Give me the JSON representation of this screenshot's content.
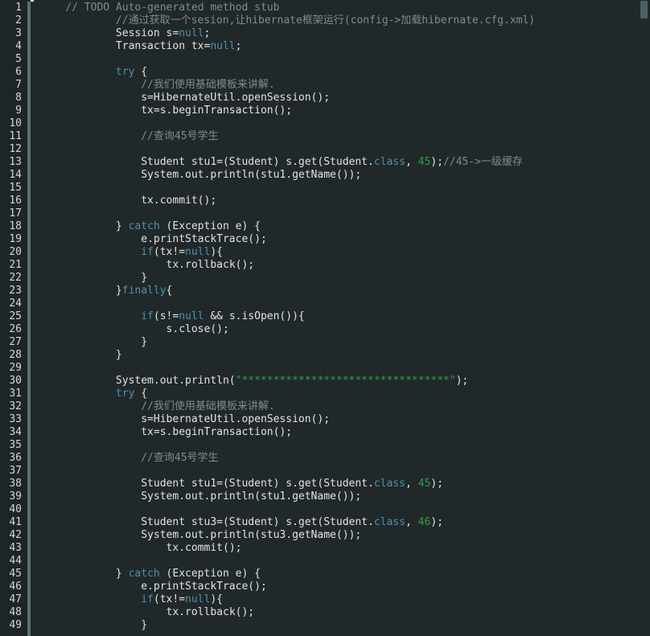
{
  "editor": {
    "title": "Java source editor",
    "language": "java",
    "theme": "dark",
    "gutter": {
      "first_line": 1,
      "last_line": 49,
      "line_count": 49
    },
    "colors": {
      "background": "#212829",
      "gutter_background": "#1e2527",
      "fold_bar": "#5b7173",
      "default_text": "#e3e3e3",
      "line_number": "#d6d6d6",
      "keyword": "#4e90b0",
      "number": "#2f9e46",
      "string": "#2f9e46",
      "comment": "#7f8c8d",
      "scrollbar_thumb": "#4c6164"
    },
    "scrollbar": {
      "orientation": "vertical",
      "thumb_position": "top"
    },
    "lines": [
      {
        "n": 1,
        "tokens": [
          {
            "t": "// TODO Auto-generated method stub",
            "c": "cmt",
            "indent": 1
          }
        ]
      },
      {
        "n": 2,
        "tokens": [
          {
            "t": "//通过获取一个sesion,让hibernate框架运行(config->加载hibernate.cfg.xml)",
            "c": "cmt",
            "indent": 3
          }
        ]
      },
      {
        "n": 3,
        "tokens": [
          {
            "t": "Session s=",
            "c": "plain",
            "indent": 3
          },
          {
            "t": "null",
            "c": "kw"
          },
          {
            "t": ";",
            "c": "plain"
          }
        ]
      },
      {
        "n": 4,
        "tokens": [
          {
            "t": "Transaction tx=",
            "c": "plain",
            "indent": 3
          },
          {
            "t": "null",
            "c": "kw"
          },
          {
            "t": ";",
            "c": "plain"
          }
        ]
      },
      {
        "n": 5,
        "tokens": []
      },
      {
        "n": 6,
        "tokens": [
          {
            "t": "try",
            "c": "kw",
            "indent": 3
          },
          {
            "t": " {",
            "c": "plain"
          }
        ]
      },
      {
        "n": 7,
        "tokens": [
          {
            "t": "//我们使用基础模板来讲解.",
            "c": "cmt",
            "indent": 4
          }
        ]
      },
      {
        "n": 8,
        "tokens": [
          {
            "t": "s=HibernateUtil.openSession();",
            "c": "plain",
            "indent": 4
          }
        ]
      },
      {
        "n": 9,
        "tokens": [
          {
            "t": "tx=s.beginTransaction();",
            "c": "plain",
            "indent": 4
          }
        ]
      },
      {
        "n": 10,
        "tokens": []
      },
      {
        "n": 11,
        "tokens": [
          {
            "t": "//查询45号学生",
            "c": "cmt",
            "indent": 4
          }
        ]
      },
      {
        "n": 12,
        "tokens": []
      },
      {
        "n": 13,
        "tokens": [
          {
            "t": "Student stu1=(Student) s.get(Student.",
            "c": "plain",
            "indent": 4
          },
          {
            "t": "class",
            "c": "kw"
          },
          {
            "t": ", ",
            "c": "plain"
          },
          {
            "t": "45",
            "c": "num"
          },
          {
            "t": ");",
            "c": "plain"
          },
          {
            "t": "//45->一级缓存",
            "c": "cmt"
          }
        ]
      },
      {
        "n": 14,
        "tokens": [
          {
            "t": "System.out.println(stu1.getName());",
            "c": "plain",
            "indent": 4
          }
        ]
      },
      {
        "n": 15,
        "tokens": []
      },
      {
        "n": 16,
        "tokens": [
          {
            "t": "tx.commit();",
            "c": "plain",
            "indent": 4
          }
        ]
      },
      {
        "n": 17,
        "tokens": []
      },
      {
        "n": 18,
        "tokens": [
          {
            "t": "} ",
            "c": "plain",
            "indent": 3
          },
          {
            "t": "catch",
            "c": "kw"
          },
          {
            "t": " (Exception e) {",
            "c": "plain"
          }
        ]
      },
      {
        "n": 19,
        "tokens": [
          {
            "t": "e.printStackTrace();",
            "c": "plain",
            "indent": 4
          }
        ]
      },
      {
        "n": 20,
        "tokens": [
          {
            "t": "if",
            "c": "kw",
            "indent": 4
          },
          {
            "t": "(tx!=",
            "c": "plain"
          },
          {
            "t": "null",
            "c": "kw"
          },
          {
            "t": "){",
            "c": "plain"
          }
        ]
      },
      {
        "n": 21,
        "tokens": [
          {
            "t": "tx.rollback();",
            "c": "plain",
            "indent": 5
          }
        ]
      },
      {
        "n": 22,
        "tokens": [
          {
            "t": "}",
            "c": "plain",
            "indent": 4
          }
        ]
      },
      {
        "n": 23,
        "tokens": [
          {
            "t": "}",
            "c": "plain",
            "indent": 3
          },
          {
            "t": "finally",
            "c": "kw"
          },
          {
            "t": "{",
            "c": "plain"
          }
        ]
      },
      {
        "n": 24,
        "tokens": []
      },
      {
        "n": 25,
        "tokens": [
          {
            "t": "if",
            "c": "kw",
            "indent": 4
          },
          {
            "t": "(s!=",
            "c": "plain"
          },
          {
            "t": "null",
            "c": "kw"
          },
          {
            "t": " && s.isOpen()){",
            "c": "plain"
          }
        ]
      },
      {
        "n": 26,
        "tokens": [
          {
            "t": "s.close();",
            "c": "plain",
            "indent": 5
          }
        ]
      },
      {
        "n": 27,
        "tokens": [
          {
            "t": "}",
            "c": "plain",
            "indent": 4
          }
        ]
      },
      {
        "n": 28,
        "tokens": [
          {
            "t": "}",
            "c": "plain",
            "indent": 3
          }
        ]
      },
      {
        "n": 29,
        "tokens": []
      },
      {
        "n": 30,
        "tokens": [
          {
            "t": "System.out.println(",
            "c": "plain",
            "indent": 3
          },
          {
            "t": "\"*********************************\"",
            "c": "str"
          },
          {
            "t": ");",
            "c": "plain"
          }
        ]
      },
      {
        "n": 31,
        "tokens": [
          {
            "t": "try",
            "c": "kw",
            "indent": 3
          },
          {
            "t": " {",
            "c": "plain"
          }
        ]
      },
      {
        "n": 32,
        "tokens": [
          {
            "t": "//我们使用基础模板来讲解.",
            "c": "cmt",
            "indent": 4
          }
        ]
      },
      {
        "n": 33,
        "tokens": [
          {
            "t": "s=HibernateUtil.openSession();",
            "c": "plain",
            "indent": 4
          }
        ]
      },
      {
        "n": 34,
        "tokens": [
          {
            "t": "tx=s.beginTransaction();",
            "c": "plain",
            "indent": 4
          }
        ]
      },
      {
        "n": 35,
        "tokens": []
      },
      {
        "n": 36,
        "tokens": [
          {
            "t": "//查询45号学生",
            "c": "cmt",
            "indent": 4
          }
        ]
      },
      {
        "n": 37,
        "tokens": []
      },
      {
        "n": 38,
        "tokens": [
          {
            "t": "Student stu1=(Student) s.get(Student.",
            "c": "plain",
            "indent": 4
          },
          {
            "t": "class",
            "c": "kw"
          },
          {
            "t": ", ",
            "c": "plain"
          },
          {
            "t": "45",
            "c": "num"
          },
          {
            "t": ");",
            "c": "plain"
          }
        ]
      },
      {
        "n": 39,
        "tokens": [
          {
            "t": "System.out.println(stu1.getName());",
            "c": "plain",
            "indent": 4
          }
        ]
      },
      {
        "n": 40,
        "tokens": []
      },
      {
        "n": 41,
        "tokens": [
          {
            "t": "Student stu3=(Student) s.get(Student.",
            "c": "plain",
            "indent": 4
          },
          {
            "t": "class",
            "c": "kw"
          },
          {
            "t": ", ",
            "c": "plain"
          },
          {
            "t": "46",
            "c": "num"
          },
          {
            "t": ");",
            "c": "plain"
          }
        ]
      },
      {
        "n": 42,
        "tokens": [
          {
            "t": "System.out.println(stu3.getName());",
            "c": "plain",
            "indent": 4
          }
        ]
      },
      {
        "n": 43,
        "tokens": [
          {
            "t": "tx.commit();",
            "c": "plain",
            "indent": 5
          }
        ]
      },
      {
        "n": 44,
        "tokens": []
      },
      {
        "n": 45,
        "tokens": [
          {
            "t": "} ",
            "c": "plain",
            "indent": 3
          },
          {
            "t": "catch",
            "c": "kw"
          },
          {
            "t": " (Exception e) {",
            "c": "plain"
          }
        ]
      },
      {
        "n": 46,
        "tokens": [
          {
            "t": "e.printStackTrace();",
            "c": "plain",
            "indent": 4
          }
        ]
      },
      {
        "n": 47,
        "tokens": [
          {
            "t": "if",
            "c": "kw",
            "indent": 4
          },
          {
            "t": "(tx!=",
            "c": "plain"
          },
          {
            "t": "null",
            "c": "kw"
          },
          {
            "t": "){",
            "c": "plain"
          }
        ]
      },
      {
        "n": 48,
        "tokens": [
          {
            "t": "tx.rollback();",
            "c": "plain",
            "indent": 5
          }
        ]
      },
      {
        "n": 49,
        "tokens": [
          {
            "t": "}",
            "c": "plain",
            "indent": 4
          }
        ]
      }
    ]
  }
}
